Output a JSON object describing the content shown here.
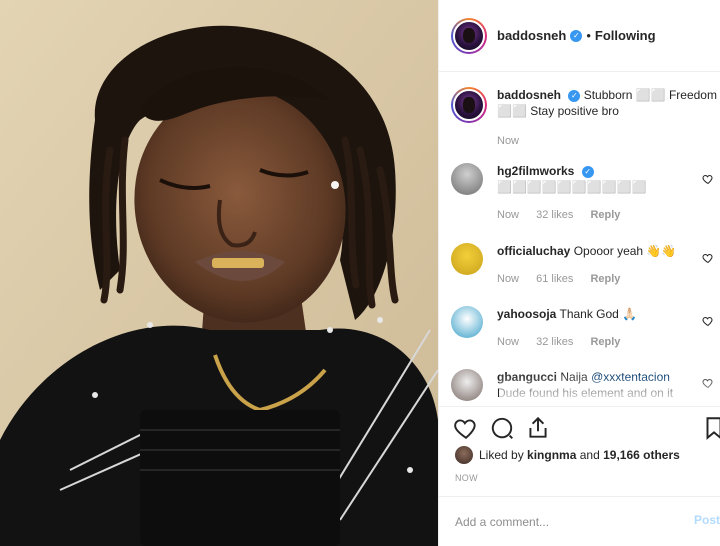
{
  "header": {
    "username": "baddosneh",
    "separator": "•",
    "follow_status": "Following"
  },
  "caption": {
    "username": "baddosneh",
    "text": "Stubborn ⬜⬜ Freedom ⬜⬜ Stay positive bro",
    "time": "Now"
  },
  "comments": [
    {
      "username": "hg2filmworks",
      "verified": true,
      "text": "⬜⬜⬜⬜⬜⬜⬜⬜⬜⬜",
      "time": "Now",
      "likes": "32 likes",
      "reply": "Reply"
    },
    {
      "username": "officialuchay",
      "verified": false,
      "text": "Opooor yeah 👋👋",
      "time": "Now",
      "likes": "61 likes",
      "reply": "Reply"
    },
    {
      "username": "yahoosoja",
      "verified": false,
      "text": "Thank God 🙏🏻",
      "time": "Now",
      "likes": "32 likes",
      "reply": "Reply"
    },
    {
      "username": "gbangucci",
      "verified": false,
      "text_prefix": "Naija",
      "mention": "@xxxtentacion",
      "text_suffix": "Dude found his element and on it",
      "time": "",
      "likes": "",
      "reply": ""
    }
  ],
  "likes": {
    "prefix": "Liked by",
    "user": "kingnma",
    "middle": "and",
    "others": "19,166 others"
  },
  "timestamp": "NOW",
  "add_comment": {
    "placeholder": "Add a comment...",
    "post_label": "Post"
  },
  "colors": {
    "accent_blue": "#3897f0",
    "post_disabled": "#b3dbff",
    "muted": "#999999"
  }
}
